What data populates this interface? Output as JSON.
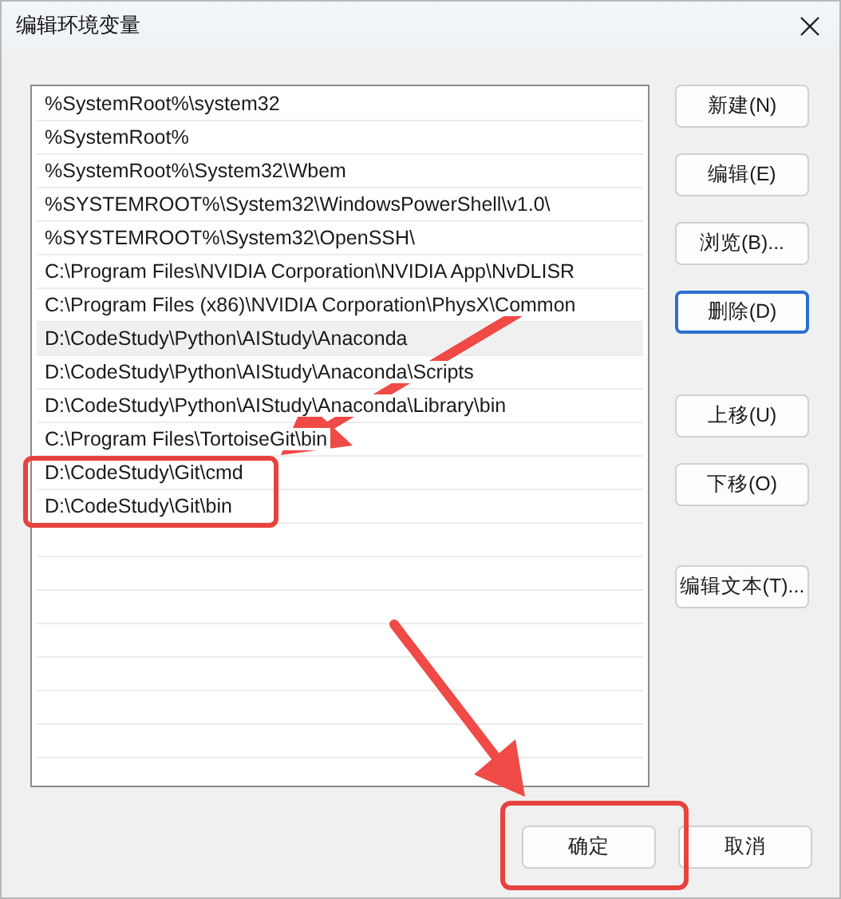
{
  "window": {
    "title": "编辑环境变量"
  },
  "paths": [
    {
      "text": "%SystemRoot%\\system32",
      "selected": false
    },
    {
      "text": "%SystemRoot%",
      "selected": false
    },
    {
      "text": "%SystemRoot%\\System32\\Wbem",
      "selected": false
    },
    {
      "text": "%SYSTEMROOT%\\System32\\WindowsPowerShell\\v1.0\\",
      "selected": false
    },
    {
      "text": "%SYSTEMROOT%\\System32\\OpenSSH\\",
      "selected": false
    },
    {
      "text": "C:\\Program Files\\NVIDIA Corporation\\NVIDIA App\\NvDLISR",
      "selected": false
    },
    {
      "text": "C:\\Program Files (x86)\\NVIDIA Corporation\\PhysX\\Common",
      "selected": false
    },
    {
      "text": "D:\\CodeStudy\\Python\\AIStudy\\Anaconda",
      "selected": true
    },
    {
      "text": "D:\\CodeStudy\\Python\\AIStudy\\Anaconda\\Scripts",
      "selected": false
    },
    {
      "text": "D:\\CodeStudy\\Python\\AIStudy\\Anaconda\\Library\\bin",
      "selected": false
    },
    {
      "text": "C:\\Program Files\\TortoiseGit\\bin",
      "selected": false
    },
    {
      "text": "D:\\CodeStudy\\Git\\cmd",
      "selected": false
    },
    {
      "text": "D:\\CodeStudy\\Git\\bin",
      "selected": false
    }
  ],
  "side_buttons": [
    {
      "label": "新建(N)",
      "focused": false
    },
    {
      "label": "编辑(E)",
      "focused": false
    },
    {
      "label": "浏览(B)...",
      "focused": false
    },
    {
      "label": "删除(D)",
      "focused": true
    },
    {
      "label": "上移(U)",
      "focused": false
    },
    {
      "label": "下移(O)",
      "focused": false
    },
    {
      "label": "编辑文本(T)...",
      "focused": false
    }
  ],
  "footer_buttons": [
    {
      "label": "确定",
      "focused": false
    },
    {
      "label": "取消",
      "focused": false
    }
  ]
}
